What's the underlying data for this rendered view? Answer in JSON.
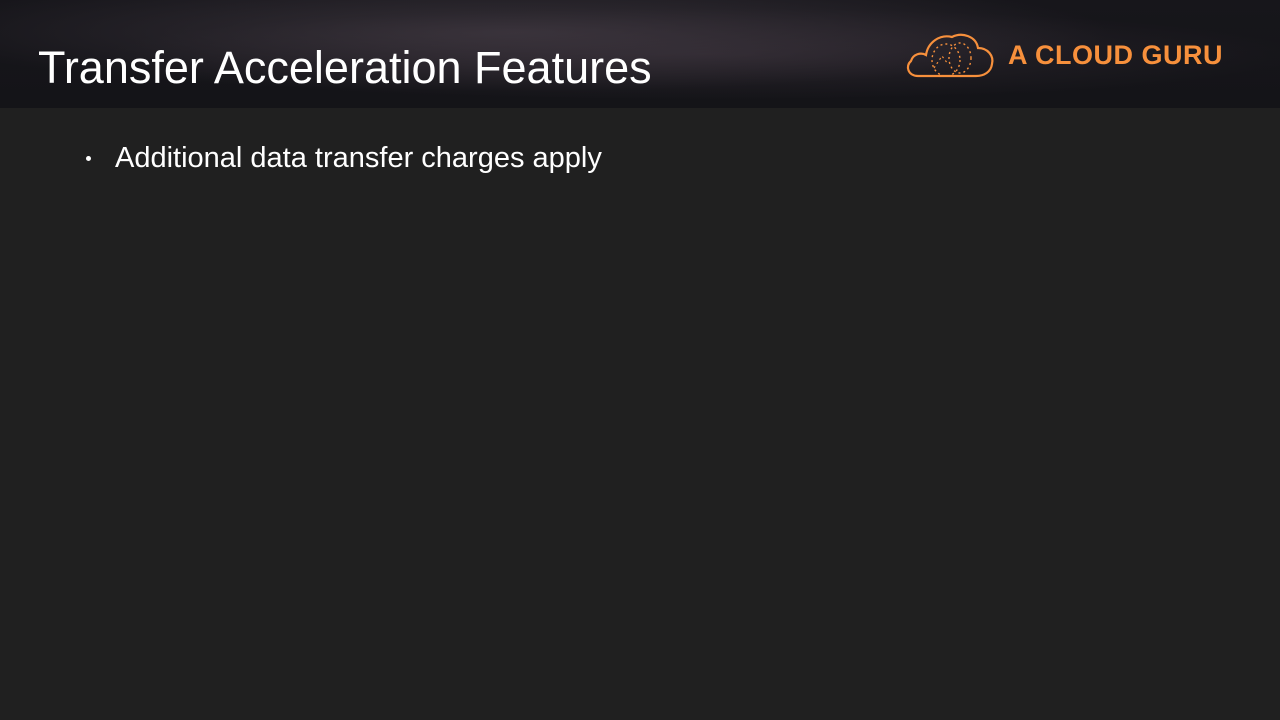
{
  "slide": {
    "title": "Transfer Acceleration Features",
    "bullets": [
      "Additional data transfer charges apply"
    ]
  },
  "logo": {
    "icon": "cloud-icon",
    "text": "A CLOUD GURU",
    "color": "#f7903c"
  },
  "colors": {
    "background": "#202020",
    "text": "#ffffff"
  }
}
